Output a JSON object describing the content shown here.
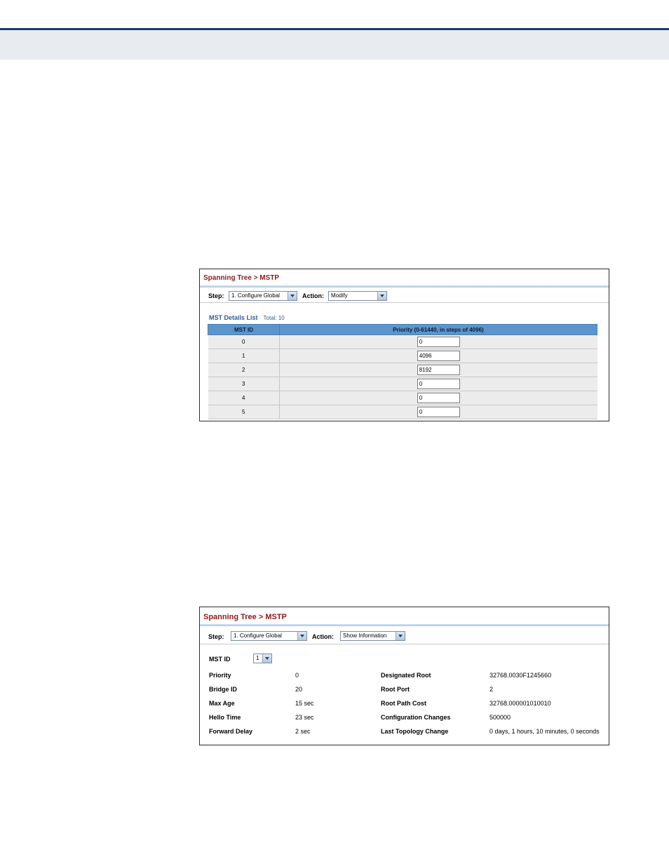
{
  "panel1": {
    "title": "Spanning Tree > MSTP",
    "step_label": "Step:",
    "step_value": "1. Configure Global",
    "action_label": "Action:",
    "action_value": "Modify",
    "list_title": "MST Details List",
    "list_total": "Total: 10",
    "columns": [
      "MST ID",
      "Priority (0-61440, in steps of 4096)"
    ],
    "rows": [
      {
        "id": "0",
        "priority": "0"
      },
      {
        "id": "1",
        "priority": "4096"
      },
      {
        "id": "2",
        "priority": "8192"
      },
      {
        "id": "3",
        "priority": "0"
      },
      {
        "id": "4",
        "priority": "0"
      },
      {
        "id": "5",
        "priority": "0"
      }
    ]
  },
  "panel2": {
    "title": "Spanning Tree > MSTP",
    "step_label": "Step:",
    "step_value": "1. Configure Global",
    "action_label": "Action:",
    "action_value": "Show Information",
    "mst_id_label": "MST ID",
    "mst_id_value": "1",
    "left": [
      {
        "label": "Priority",
        "value": "0"
      },
      {
        "label": "Bridge ID",
        "value": "20"
      },
      {
        "label": "Max Age",
        "value": "15 sec"
      },
      {
        "label": "Hello Time",
        "value": "23 sec"
      },
      {
        "label": "Forward Delay",
        "value": "2 sec"
      }
    ],
    "right": [
      {
        "label": "Designated Root",
        "value": "32768.0030F1245660"
      },
      {
        "label": "Root Port",
        "value": "2"
      },
      {
        "label": "Root Path Cost",
        "value": "32768.000001010010"
      },
      {
        "label": "Configuration Changes",
        "value": "500000"
      },
      {
        "label": "Last Topology Change",
        "value": "0 days, 1 hours, 10 minutes, 0 seconds"
      }
    ]
  },
  "icons": {
    "dropdown": "chevron-down-icon"
  },
  "colors": {
    "title": "#8b1a1a",
    "table_header": "#5b95cc",
    "header_rule": "#1c3a6e"
  }
}
